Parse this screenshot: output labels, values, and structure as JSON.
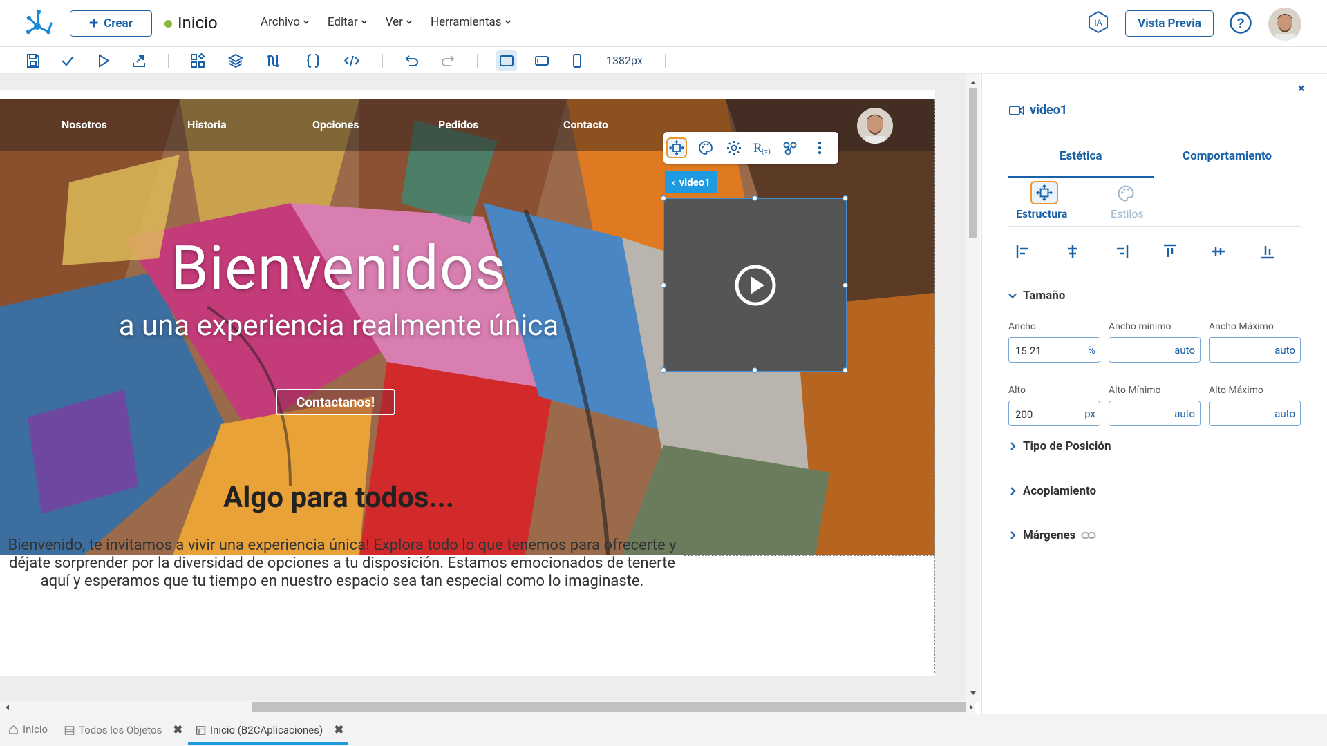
{
  "header": {
    "create_label": "Crear",
    "app_title": "Inicio",
    "status_color": "#8fb63f",
    "menus": [
      "Archivo",
      "Editar",
      "Ver",
      "Herramientas"
    ],
    "ia_label": "IA",
    "preview_label": "Vista Previa"
  },
  "toolbar": {
    "icons": [
      "save-icon",
      "check-icon",
      "play-icon",
      "export-icon",
      "components-icon",
      "layers-icon",
      "variables-icon",
      "braces-icon",
      "code-icon",
      "undo-icon",
      "redo-icon",
      "desktop-view-icon",
      "tablet-view-icon",
      "mobile-view-icon"
    ],
    "width_readout": "1382px"
  },
  "canvas": {
    "nav_links": [
      "Nosotros",
      "Historia",
      "Opciones",
      "Pedidos",
      "Contacto"
    ],
    "hero_title": "Bienvenidos",
    "hero_subtitle": "a una experiencia realmente única",
    "hero_button": "Contactanos!",
    "card_title": "Algo para todos...",
    "card_body": [
      "Bienvenido, te invitamos a vivir una experiencia única! Explora todo lo que tenemos para ofrecerte y",
      "déjate sorprender por la diversidad de opciones a tu disposición. Estamos emocionados de tenerte",
      "aquí y esperamos que tu tiempo en nuestro espacio sea tan especial como lo imaginaste."
    ],
    "selected_element": "video1",
    "selection_color": "#3f8fd0",
    "highlight_color": "#f0932a"
  },
  "panel": {
    "element_name": "video1",
    "tabs": [
      "Estética",
      "Comportamiento"
    ],
    "subtabs": [
      "Estructura",
      "Estilos"
    ],
    "size_section": "Tamaño",
    "fields": {
      "width_label": "Ancho",
      "width_value": "15.21",
      "width_unit": "%",
      "min_width_label": "Ancho mínimo",
      "min_width_value": "auto",
      "max_width_label": "Ancho Máximo",
      "max_width_value": "auto",
      "height_label": "Alto",
      "height_value": "200",
      "height_unit": "px",
      "min_height_label": "Alto Mínimo",
      "min_height_value": "auto",
      "max_height_label": "Alto Máximo",
      "max_height_value": "auto"
    },
    "sections": [
      "Tipo de Posición",
      "Acoplamiento",
      "Márgenes"
    ]
  },
  "bottom_tabs": [
    "Inicio",
    "Todos los Objetos",
    "Inicio (B2CAplicaciones)"
  ]
}
